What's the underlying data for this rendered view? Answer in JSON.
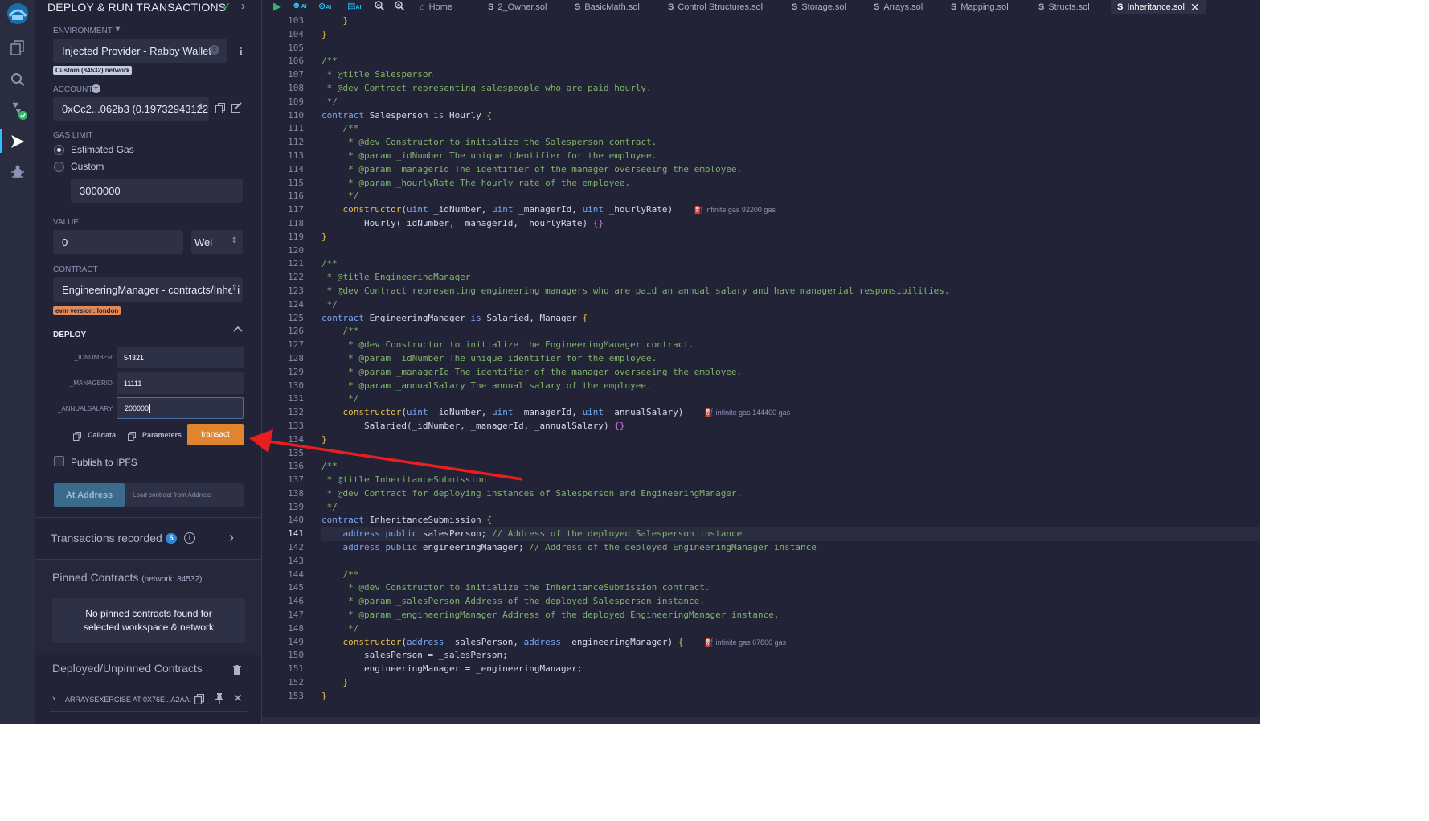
{
  "panel": {
    "title": "DEPLOY & RUN TRANSACTIONS",
    "environment_label": "ENVIRONMENT",
    "environment_value": "Injected Provider - Rabby Wallet",
    "network_badge": "Custom (84532) network",
    "account_label": "ACCOUNT",
    "account_value": "0xCc2...062b3 (0.19732943122",
    "gas_limit_label": "GAS LIMIT",
    "gas_estimated": "Estimated Gas",
    "gas_custom": "Custom",
    "gas_value": "3000000",
    "value_label": "VALUE",
    "value_amount": "0",
    "value_unit": "Wei",
    "contract_label": "CONTRACT",
    "contract_value": "EngineeringManager - contracts/Inheri",
    "evm_badge": "evm version: london",
    "deploy_label": "DEPLOY",
    "params": [
      {
        "label": "_IDNUMBER:",
        "value": "54321"
      },
      {
        "label": "_MANAGERID:",
        "value": "11111"
      },
      {
        "label": "_ANNUALSALARY:",
        "value": "200000"
      }
    ],
    "calldata_label": "Calldata",
    "parameters_label": "Parameters",
    "transact_label": "transact",
    "ipfs_label": "Publish to IPFS",
    "at_address_label": "At Address",
    "load_address_placeholder": "Load contract from Address",
    "transactions_label": "Transactions recorded",
    "transactions_count": "5",
    "pinned_title": "Pinned Contracts",
    "pinned_network": "(network: 84532)",
    "pinned_empty": "No pinned contracts found for selected workspace & network",
    "deployed_title": "Deployed/Unpinned Contracts",
    "deployed_item": "ARRAYSEXERCISE AT 0X76E...A2AA:"
  },
  "tabs": [
    {
      "label": "Home",
      "glyph": "⌂"
    },
    {
      "label": "2_Owner.sol",
      "glyph": "S"
    },
    {
      "label": "BasicMath.sol",
      "glyph": "S"
    },
    {
      "label": "Control Structures.sol",
      "glyph": "S"
    },
    {
      "label": "Storage.sol",
      "glyph": "S"
    },
    {
      "label": "Arrays.sol",
      "glyph": "S"
    },
    {
      "label": "Mapping.sol",
      "glyph": "S"
    },
    {
      "label": "Structs.sol",
      "glyph": "S"
    },
    {
      "label": "Inheritance.sol",
      "glyph": "S"
    }
  ],
  "ai_label": "AI",
  "current_line": 141,
  "first_line": 103,
  "code_lines": [
    [
      [
        "    }",
        "y"
      ]
    ],
    [
      [
        "}",
        "y"
      ]
    ],
    [],
    [
      [
        "/**",
        "c"
      ]
    ],
    [
      [
        " * @title Salesperson",
        "c"
      ]
    ],
    [
      [
        " * @dev Contract representing salespeople who are paid hourly.",
        "c"
      ]
    ],
    [
      [
        " */",
        "c"
      ]
    ],
    [
      [
        "contract ",
        "k"
      ],
      [
        "Salesperson ",
        "w"
      ],
      [
        "is ",
        "k"
      ],
      [
        "Hourly ",
        "w"
      ],
      [
        "{",
        "y"
      ]
    ],
    [
      [
        "    /**",
        "c"
      ]
    ],
    [
      [
        "     * @dev Constructor to initialize the Salesperson contract.",
        "c"
      ]
    ],
    [
      [
        "     * @param _idNumber The unique identifier for the employee.",
        "c"
      ]
    ],
    [
      [
        "     * @param _managerId The identifier of the manager overseeing the employee.",
        "c"
      ]
    ],
    [
      [
        "     * @param _hourlyRate The hourly rate of the employee.",
        "c"
      ]
    ],
    [
      [
        "     */",
        "c"
      ]
    ],
    [
      [
        "    constructor",
        "y"
      ],
      [
        "(",
        "w"
      ],
      [
        "uint ",
        "k"
      ],
      [
        "_idNumber, ",
        "w"
      ],
      [
        "uint ",
        "k"
      ],
      [
        "_managerId, ",
        "w"
      ],
      [
        "uint ",
        "k"
      ],
      [
        "_hourlyRate)    ",
        "w"
      ],
      [
        "⛽ infinite gas 92200 gas",
        "gas"
      ]
    ],
    [
      [
        "        Hourly(_idNumber, _managerId, _hourlyRate) ",
        "w"
      ],
      [
        "{}",
        "p"
      ]
    ],
    [
      [
        "}",
        "y"
      ]
    ],
    [],
    [
      [
        "/**",
        "c"
      ]
    ],
    [
      [
        " * @title EngineeringManager",
        "c"
      ]
    ],
    [
      [
        " * @dev Contract representing engineering managers who are paid an annual salary and have managerial responsibilities.",
        "c"
      ]
    ],
    [
      [
        " */",
        "c"
      ]
    ],
    [
      [
        "contract ",
        "k"
      ],
      [
        "EngineeringManager ",
        "w"
      ],
      [
        "is ",
        "k"
      ],
      [
        "Salaried, Manager ",
        "w"
      ],
      [
        "{",
        "y"
      ]
    ],
    [
      [
        "    /**",
        "c"
      ]
    ],
    [
      [
        "     * @dev Constructor to initialize the EngineeringManager contract.",
        "c"
      ]
    ],
    [
      [
        "     * @param _idNumber The unique identifier for the employee.",
        "c"
      ]
    ],
    [
      [
        "     * @param _managerId The identifier of the manager overseeing the employee.",
        "c"
      ]
    ],
    [
      [
        "     * @param _annualSalary The annual salary of the employee.",
        "c"
      ]
    ],
    [
      [
        "     */",
        "c"
      ]
    ],
    [
      [
        "    constructor",
        "y"
      ],
      [
        "(",
        "w"
      ],
      [
        "uint ",
        "k"
      ],
      [
        "_idNumber, ",
        "w"
      ],
      [
        "uint ",
        "k"
      ],
      [
        "_managerId, ",
        "w"
      ],
      [
        "uint ",
        "k"
      ],
      [
        "_annualSalary)    ",
        "w"
      ],
      [
        "⛽ infinite gas 144400 gas",
        "gas"
      ]
    ],
    [
      [
        "        Salaried(_idNumber, _managerId, _annualSalary) ",
        "w"
      ],
      [
        "{}",
        "p"
      ]
    ],
    [
      [
        "}",
        "y"
      ]
    ],
    [],
    [
      [
        "/**",
        "c"
      ]
    ],
    [
      [
        " * @title InheritanceSubmission",
        "c"
      ]
    ],
    [
      [
        " * @dev Contract for deploying instances of Salesperson and EngineeringManager.",
        "c"
      ]
    ],
    [
      [
        " */",
        "c"
      ]
    ],
    [
      [
        "contract ",
        "k"
      ],
      [
        "InheritanceSubmission ",
        "w"
      ],
      [
        "{",
        "y"
      ]
    ],
    [
      [
        "    address ",
        "k"
      ],
      [
        "public ",
        "k"
      ],
      [
        "salesPerson; ",
        "w"
      ],
      [
        "// Address of the deployed Salesperson instance",
        "c"
      ]
    ],
    [
      [
        "    address ",
        "k"
      ],
      [
        "public ",
        "k"
      ],
      [
        "engineeringManager; ",
        "w"
      ],
      [
        "// Address of the deployed EngineeringManager instance",
        "c"
      ]
    ],
    [],
    [
      [
        "    /**",
        "c"
      ]
    ],
    [
      [
        "     * @dev Constructor to initialize the InheritanceSubmission contract.",
        "c"
      ]
    ],
    [
      [
        "     * @param _salesPerson Address of the deployed Salesperson instance.",
        "c"
      ]
    ],
    [
      [
        "     * @param _engineeringManager Address of the deployed EngineeringManager instance.",
        "c"
      ]
    ],
    [
      [
        "     */",
        "c"
      ]
    ],
    [
      [
        "    constructor",
        "y"
      ],
      [
        "(",
        "w"
      ],
      [
        "address ",
        "k"
      ],
      [
        "_salesPerson, ",
        "w"
      ],
      [
        "address ",
        "k"
      ],
      [
        "_engineeringManager) ",
        "w"
      ],
      [
        "{    ",
        "y"
      ],
      [
        "⛽ infinite gas 67800 gas",
        "gas"
      ]
    ],
    [
      [
        "        salesPerson = _salesPerson;",
        "w"
      ]
    ],
    [
      [
        "        engineeringManager = _engineeringManager;",
        "w"
      ]
    ],
    [
      [
        "    }",
        "y"
      ]
    ],
    [
      [
        "}",
        "y"
      ]
    ]
  ]
}
